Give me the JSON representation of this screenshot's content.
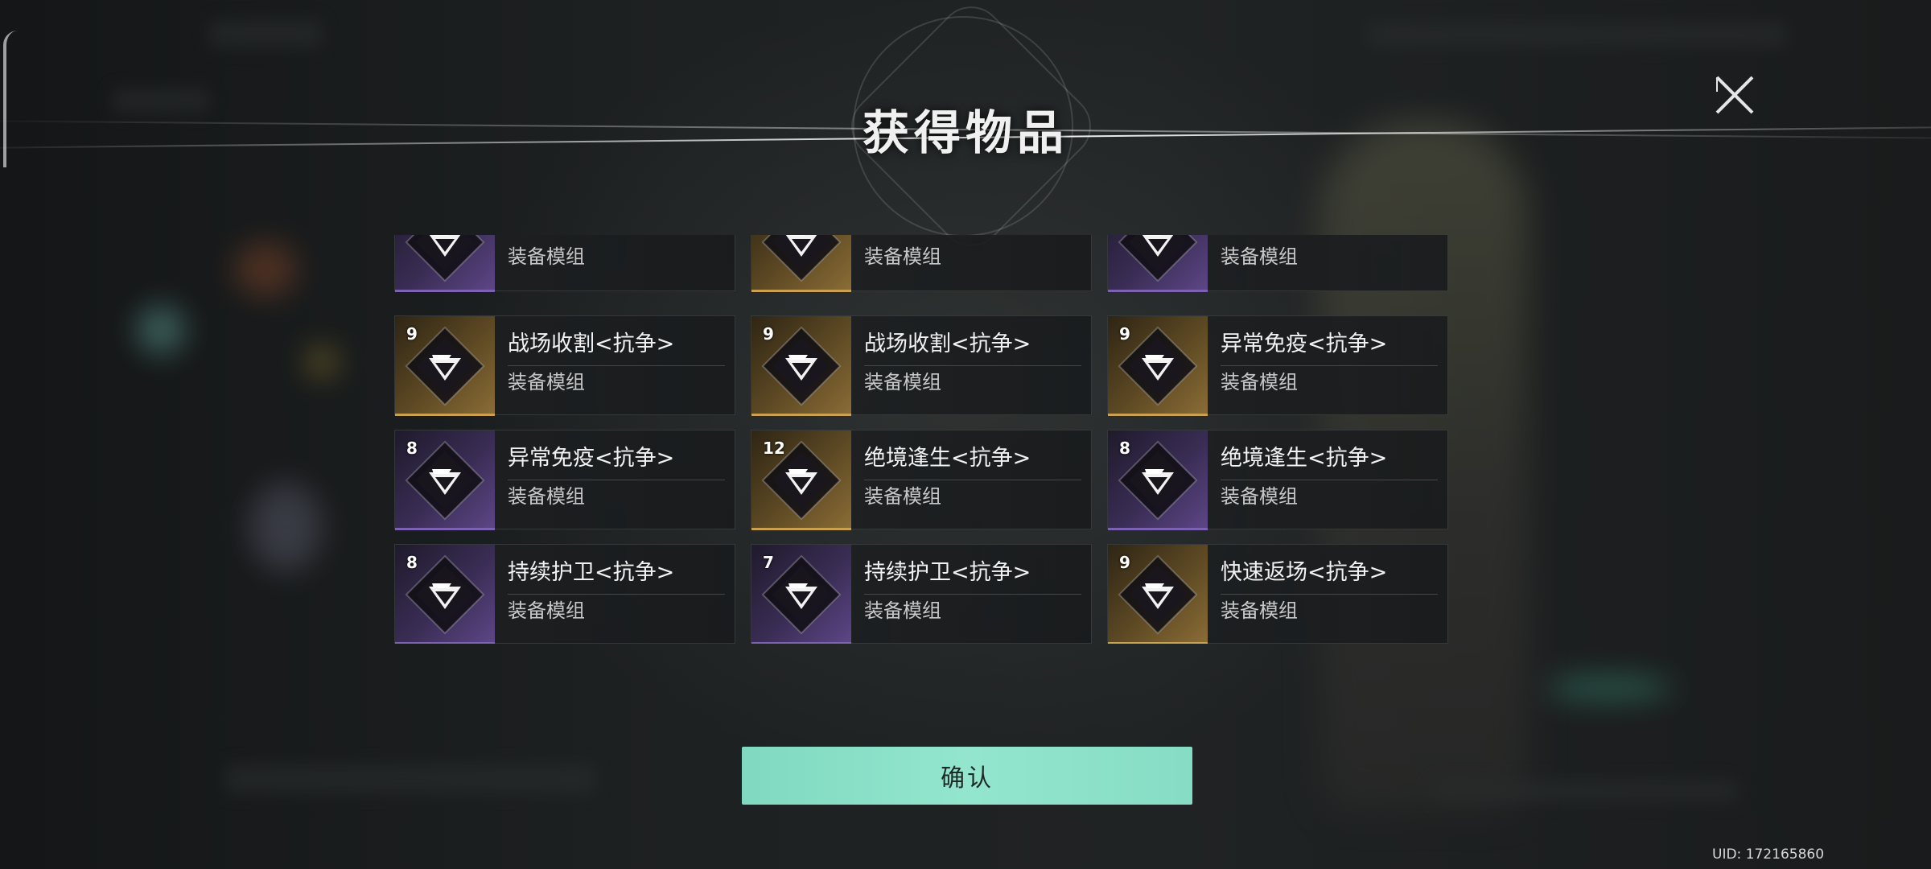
{
  "dialog": {
    "title": "获得物品",
    "close_icon": "close-x-icon",
    "confirm_label": "确认"
  },
  "items": [
    {
      "count": "",
      "name": "",
      "type": "装备模组",
      "rarity": "purple",
      "icon": "module-emblem-icon"
    },
    {
      "count": "",
      "name": "",
      "type": "装备模组",
      "rarity": "gold",
      "icon": "module-emblem-icon"
    },
    {
      "count": "",
      "name": "",
      "type": "装备模组",
      "rarity": "purple",
      "icon": "module-emblem-icon"
    },
    {
      "count": "9",
      "name": "战场收割<抗争>",
      "type": "装备模组",
      "rarity": "gold",
      "icon": "module-emblem-icon"
    },
    {
      "count": "9",
      "name": "战场收割<抗争>",
      "type": "装备模组",
      "rarity": "gold",
      "icon": "module-emblem-icon"
    },
    {
      "count": "9",
      "name": "异常免疫<抗争>",
      "type": "装备模组",
      "rarity": "gold",
      "icon": "module-emblem-icon"
    },
    {
      "count": "8",
      "name": "异常免疫<抗争>",
      "type": "装备模组",
      "rarity": "purple",
      "icon": "module-emblem-icon"
    },
    {
      "count": "12",
      "name": "绝境逢生<抗争>",
      "type": "装备模组",
      "rarity": "gold",
      "icon": "module-emblem-icon"
    },
    {
      "count": "8",
      "name": "绝境逢生<抗争>",
      "type": "装备模组",
      "rarity": "purple",
      "icon": "module-emblem-icon"
    },
    {
      "count": "8",
      "name": "持续护卫<抗争>",
      "type": "装备模组",
      "rarity": "purple",
      "icon": "module-emblem-icon"
    },
    {
      "count": "7",
      "name": "持续护卫<抗争>",
      "type": "装备模组",
      "rarity": "purple",
      "icon": "module-emblem-icon"
    },
    {
      "count": "9",
      "name": "快速返场<抗争>",
      "type": "装备模组",
      "rarity": "gold",
      "icon": "module-emblem-icon"
    }
  ],
  "footer": {
    "uid": "UID: 172165860"
  },
  "colors": {
    "confirm": "#8fe3cb",
    "gold": "#c9a150",
    "purple": "#7d62b4"
  }
}
